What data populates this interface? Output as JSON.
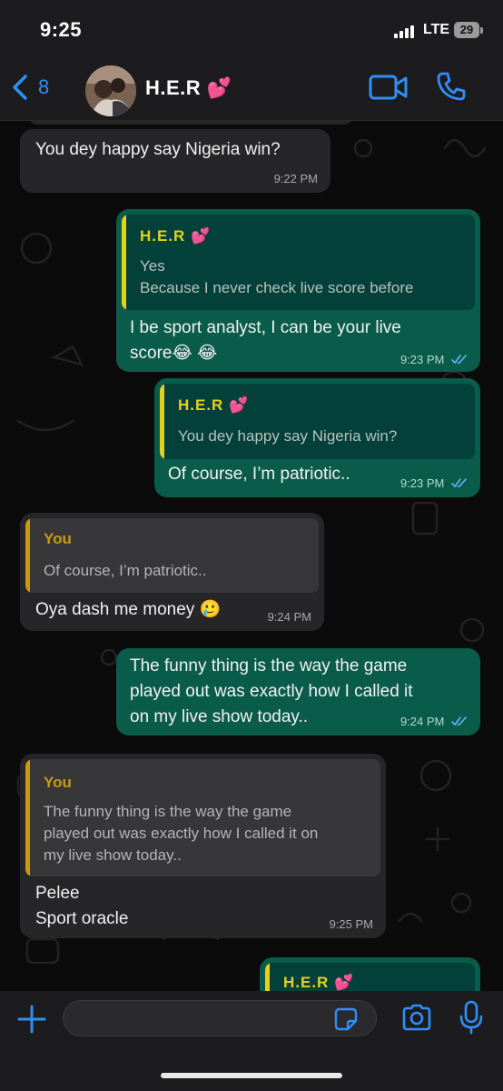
{
  "status_bar": {
    "time": "9:25",
    "network": "LTE",
    "battery": "29"
  },
  "header": {
    "back_count": "8",
    "contact_name": "H.E.R 💕"
  },
  "messages": [
    {
      "direction": "in",
      "text": "You dey happy say Nigeria win?",
      "time": "9:22 PM"
    },
    {
      "direction": "out",
      "quote_name": "H.E.R 💕",
      "quote_text": "Yes\nBecause I never check live score before",
      "text": "I be sport analyst, I can be your live\nscore😂 😂",
      "time": "9:23 PM"
    },
    {
      "direction": "out",
      "quote_name": "H.E.R 💕",
      "quote_text": "You dey happy say Nigeria win?",
      "text": "Of course, I’m patriotic..",
      "time": "9:23 PM"
    },
    {
      "direction": "in",
      "quote_name": "You",
      "quote_text": "Of course, I’m patriotic..",
      "text": "Oya dash me money 🥲",
      "time": "9:24 PM"
    },
    {
      "direction": "out",
      "text": "The funny thing is the way the game\nplayed out was exactly how I called it\non my live show today..",
      "time": "9:24 PM"
    },
    {
      "direction": "in",
      "quote_name": "You",
      "quote_text": "The funny thing is the way the game\nplayed out was exactly how I called it on\nmy live show today..",
      "text": "Pelee\nSport oracle",
      "time": "9:25 PM"
    },
    {
      "direction": "out",
      "quote_name": "H.E.R 💕"
    }
  ],
  "composer": {
    "value": "",
    "placeholder": ""
  },
  "icons": {
    "back": "chevron-left-icon",
    "video": "video-camera-icon",
    "phone": "phone-icon",
    "plus": "plus-icon",
    "sticker": "sticker-icon",
    "camera": "camera-icon",
    "mic": "microphone-icon"
  },
  "colors": {
    "accent": "#2f8ff7",
    "outgoing_bubble": "#0a5c4a",
    "incoming_bubble": "#262628",
    "quote_name_outgoing": "#e3d21a",
    "quote_name_incoming": "#c79a10",
    "read_ticks": "#5fb3ff"
  }
}
